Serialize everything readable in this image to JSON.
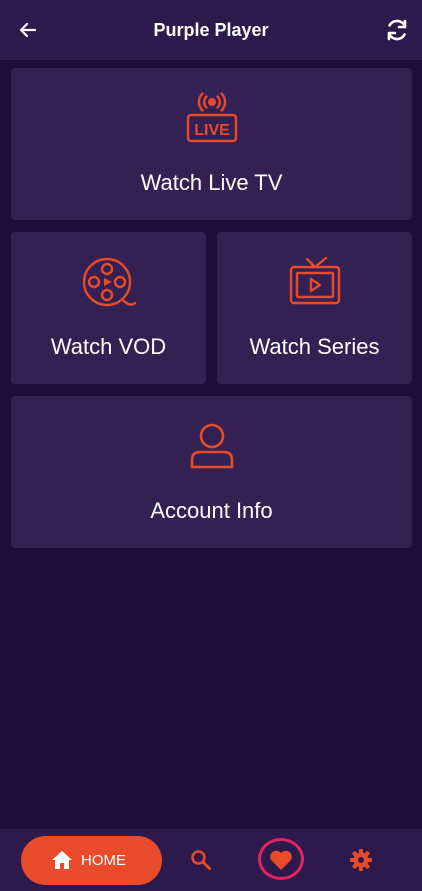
{
  "header": {
    "title": "Purple Player",
    "back_icon": "arrow-left-icon",
    "refresh_icon": "refresh-icon"
  },
  "tiles": [
    {
      "label": "Watch Live TV",
      "icon": "live-tv-icon"
    },
    {
      "label": "Watch VOD",
      "icon": "film-reel-icon"
    },
    {
      "label": "Watch Series",
      "icon": "tv-play-icon"
    },
    {
      "label": "Account Info",
      "icon": "user-icon"
    }
  ],
  "nav": {
    "home_label": "HOME",
    "home_icon": "home-icon",
    "search_icon": "search-icon",
    "favorites_icon": "heart-icon",
    "settings_icon": "gear-icon"
  },
  "colors": {
    "background": "#1e0c3a",
    "bar": "#2c1a4d",
    "card": "#332154",
    "accent": "#e94a29",
    "highlight_ring": "#e0245e"
  }
}
